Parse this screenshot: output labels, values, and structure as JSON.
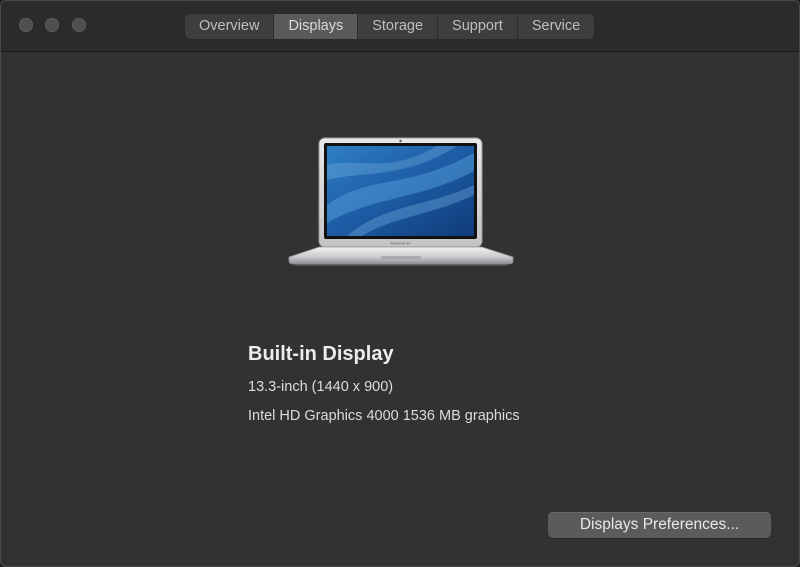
{
  "window": {
    "tabs": [
      {
        "label": "Overview",
        "active": false
      },
      {
        "label": "Displays",
        "active": true
      },
      {
        "label": "Storage",
        "active": false
      },
      {
        "label": "Support",
        "active": false
      },
      {
        "label": "Service",
        "active": false
      }
    ]
  },
  "display": {
    "name": "Built-in Display",
    "resolution": "13.3-inch (1440 x 900)",
    "graphics": "Intel HD Graphics 4000 1536 MB graphics",
    "image_icon": "macbook-air-icon"
  },
  "actions": {
    "preferences_label": "Displays Preferences..."
  },
  "colors": {
    "background": "#323235",
    "titlebar": "#2b2b2d",
    "active_tab": "#5a5a5d",
    "button": "#5b5b5e"
  }
}
